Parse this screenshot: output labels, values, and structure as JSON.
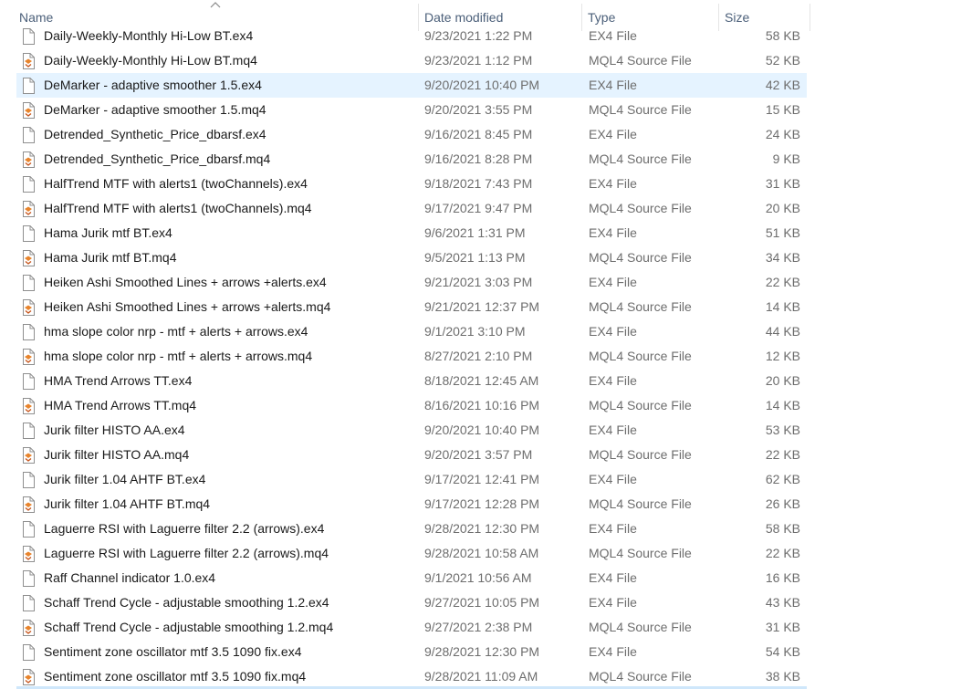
{
  "columns": {
    "name": "Name",
    "date": "Date modified",
    "type": "Type",
    "size": "Size"
  },
  "sort": {
    "column": "name",
    "direction": "ascending",
    "icon": "chevron-up-icon"
  },
  "selected_index": 2,
  "files": [
    {
      "name": "Daily-Weekly-Monthly Hi-Low BT.ex4",
      "date": "9/23/2021 1:22 PM",
      "type": "EX4 File",
      "size": "58 KB",
      "icon": "file-icon"
    },
    {
      "name": "Daily-Weekly-Monthly Hi-Low BT.mq4",
      "date": "9/23/2021 1:12 PM",
      "type": "MQL4 Source File",
      "size": "52 KB",
      "icon": "mql4-file-icon"
    },
    {
      "name": "DeMarker - adaptive smoother 1.5.ex4",
      "date": "9/20/2021 10:40 PM",
      "type": "EX4 File",
      "size": "42 KB",
      "icon": "file-icon"
    },
    {
      "name": "DeMarker - adaptive smoother 1.5.mq4",
      "date": "9/20/2021 3:55 PM",
      "type": "MQL4 Source File",
      "size": "15 KB",
      "icon": "mql4-file-icon"
    },
    {
      "name": "Detrended_Synthetic_Price_dbarsf.ex4",
      "date": "9/16/2021 8:45 PM",
      "type": "EX4 File",
      "size": "24 KB",
      "icon": "file-icon"
    },
    {
      "name": "Detrended_Synthetic_Price_dbarsf.mq4",
      "date": "9/16/2021 8:28 PM",
      "type": "MQL4 Source File",
      "size": "9 KB",
      "icon": "mql4-file-icon"
    },
    {
      "name": "HalfTrend MTF with alerts1 (twoChannels).ex4",
      "date": "9/18/2021 7:43 PM",
      "type": "EX4 File",
      "size": "31 KB",
      "icon": "file-icon"
    },
    {
      "name": "HalfTrend MTF with alerts1 (twoChannels).mq4",
      "date": "9/17/2021 9:47 PM",
      "type": "MQL4 Source File",
      "size": "20 KB",
      "icon": "mql4-file-icon"
    },
    {
      "name": "Hama Jurik mtf BT.ex4",
      "date": "9/6/2021 1:31 PM",
      "type": "EX4 File",
      "size": "51 KB",
      "icon": "file-icon"
    },
    {
      "name": "Hama Jurik mtf BT.mq4",
      "date": "9/5/2021 1:13 PM",
      "type": "MQL4 Source File",
      "size": "34 KB",
      "icon": "mql4-file-icon"
    },
    {
      "name": "Heiken Ashi Smoothed Lines + arrows +alerts.ex4",
      "date": "9/21/2021 3:03 PM",
      "type": "EX4 File",
      "size": "22 KB",
      "icon": "file-icon"
    },
    {
      "name": "Heiken Ashi Smoothed Lines + arrows +alerts.mq4",
      "date": "9/21/2021 12:37 PM",
      "type": "MQL4 Source File",
      "size": "14 KB",
      "icon": "mql4-file-icon"
    },
    {
      "name": "hma slope color nrp - mtf + alerts + arrows.ex4",
      "date": "9/1/2021 3:10 PM",
      "type": "EX4 File",
      "size": "44 KB",
      "icon": "file-icon"
    },
    {
      "name": "hma slope color nrp - mtf + alerts + arrows.mq4",
      "date": "8/27/2021 2:10 PM",
      "type": "MQL4 Source File",
      "size": "12 KB",
      "icon": "mql4-file-icon"
    },
    {
      "name": "HMA Trend Arrows TT.ex4",
      "date": "8/18/2021 12:45 AM",
      "type": "EX4 File",
      "size": "20 KB",
      "icon": "file-icon"
    },
    {
      "name": "HMA Trend Arrows TT.mq4",
      "date": "8/16/2021 10:16 PM",
      "type": "MQL4 Source File",
      "size": "14 KB",
      "icon": "mql4-file-icon"
    },
    {
      "name": "Jurik filter  HISTO AA.ex4",
      "date": "9/20/2021 10:40 PM",
      "type": "EX4 File",
      "size": "53 KB",
      "icon": "file-icon"
    },
    {
      "name": "Jurik filter  HISTO AA.mq4",
      "date": "9/20/2021 3:57 PM",
      "type": "MQL4 Source File",
      "size": "22 KB",
      "icon": "mql4-file-icon"
    },
    {
      "name": "Jurik filter 1.04 AHTF BT.ex4",
      "date": "9/17/2021 12:41 PM",
      "type": "EX4 File",
      "size": "62 KB",
      "icon": "file-icon"
    },
    {
      "name": "Jurik filter 1.04 AHTF BT.mq4",
      "date": "9/17/2021 12:28 PM",
      "type": "MQL4 Source File",
      "size": "26 KB",
      "icon": "mql4-file-icon"
    },
    {
      "name": "Laguerre RSI with Laguerre filter 2.2 (arrows).ex4",
      "date": "9/28/2021 12:30 PM",
      "type": "EX4 File",
      "size": "58 KB",
      "icon": "file-icon"
    },
    {
      "name": "Laguerre RSI with Laguerre filter 2.2 (arrows).mq4",
      "date": "9/28/2021 10:58 AM",
      "type": "MQL4 Source File",
      "size": "22 KB",
      "icon": "mql4-file-icon"
    },
    {
      "name": "Raff Channel indicator 1.0.ex4",
      "date": "9/1/2021 10:56 AM",
      "type": "EX4 File",
      "size": "16 KB",
      "icon": "file-icon"
    },
    {
      "name": "Schaff Trend Cycle - adjustable smoothing 1.2.ex4",
      "date": "9/27/2021 10:05 PM",
      "type": "EX4 File",
      "size": "43 KB",
      "icon": "file-icon"
    },
    {
      "name": "Schaff Trend Cycle - adjustable smoothing 1.2.mq4",
      "date": "9/27/2021 2:38 PM",
      "type": "MQL4 Source File",
      "size": "31 KB",
      "icon": "mql4-file-icon"
    },
    {
      "name": "Sentiment zone oscillator mtf 3.5 1090 fix.ex4",
      "date": "9/28/2021 12:30 PM",
      "type": "EX4 File",
      "size": "54 KB",
      "icon": "file-icon"
    },
    {
      "name": "Sentiment zone oscillator mtf 3.5 1090 fix.mq4",
      "date": "9/28/2021 11:09 AM",
      "type": "MQL4 Source File",
      "size": "38 KB",
      "icon": "mql4-file-icon"
    }
  ]
}
